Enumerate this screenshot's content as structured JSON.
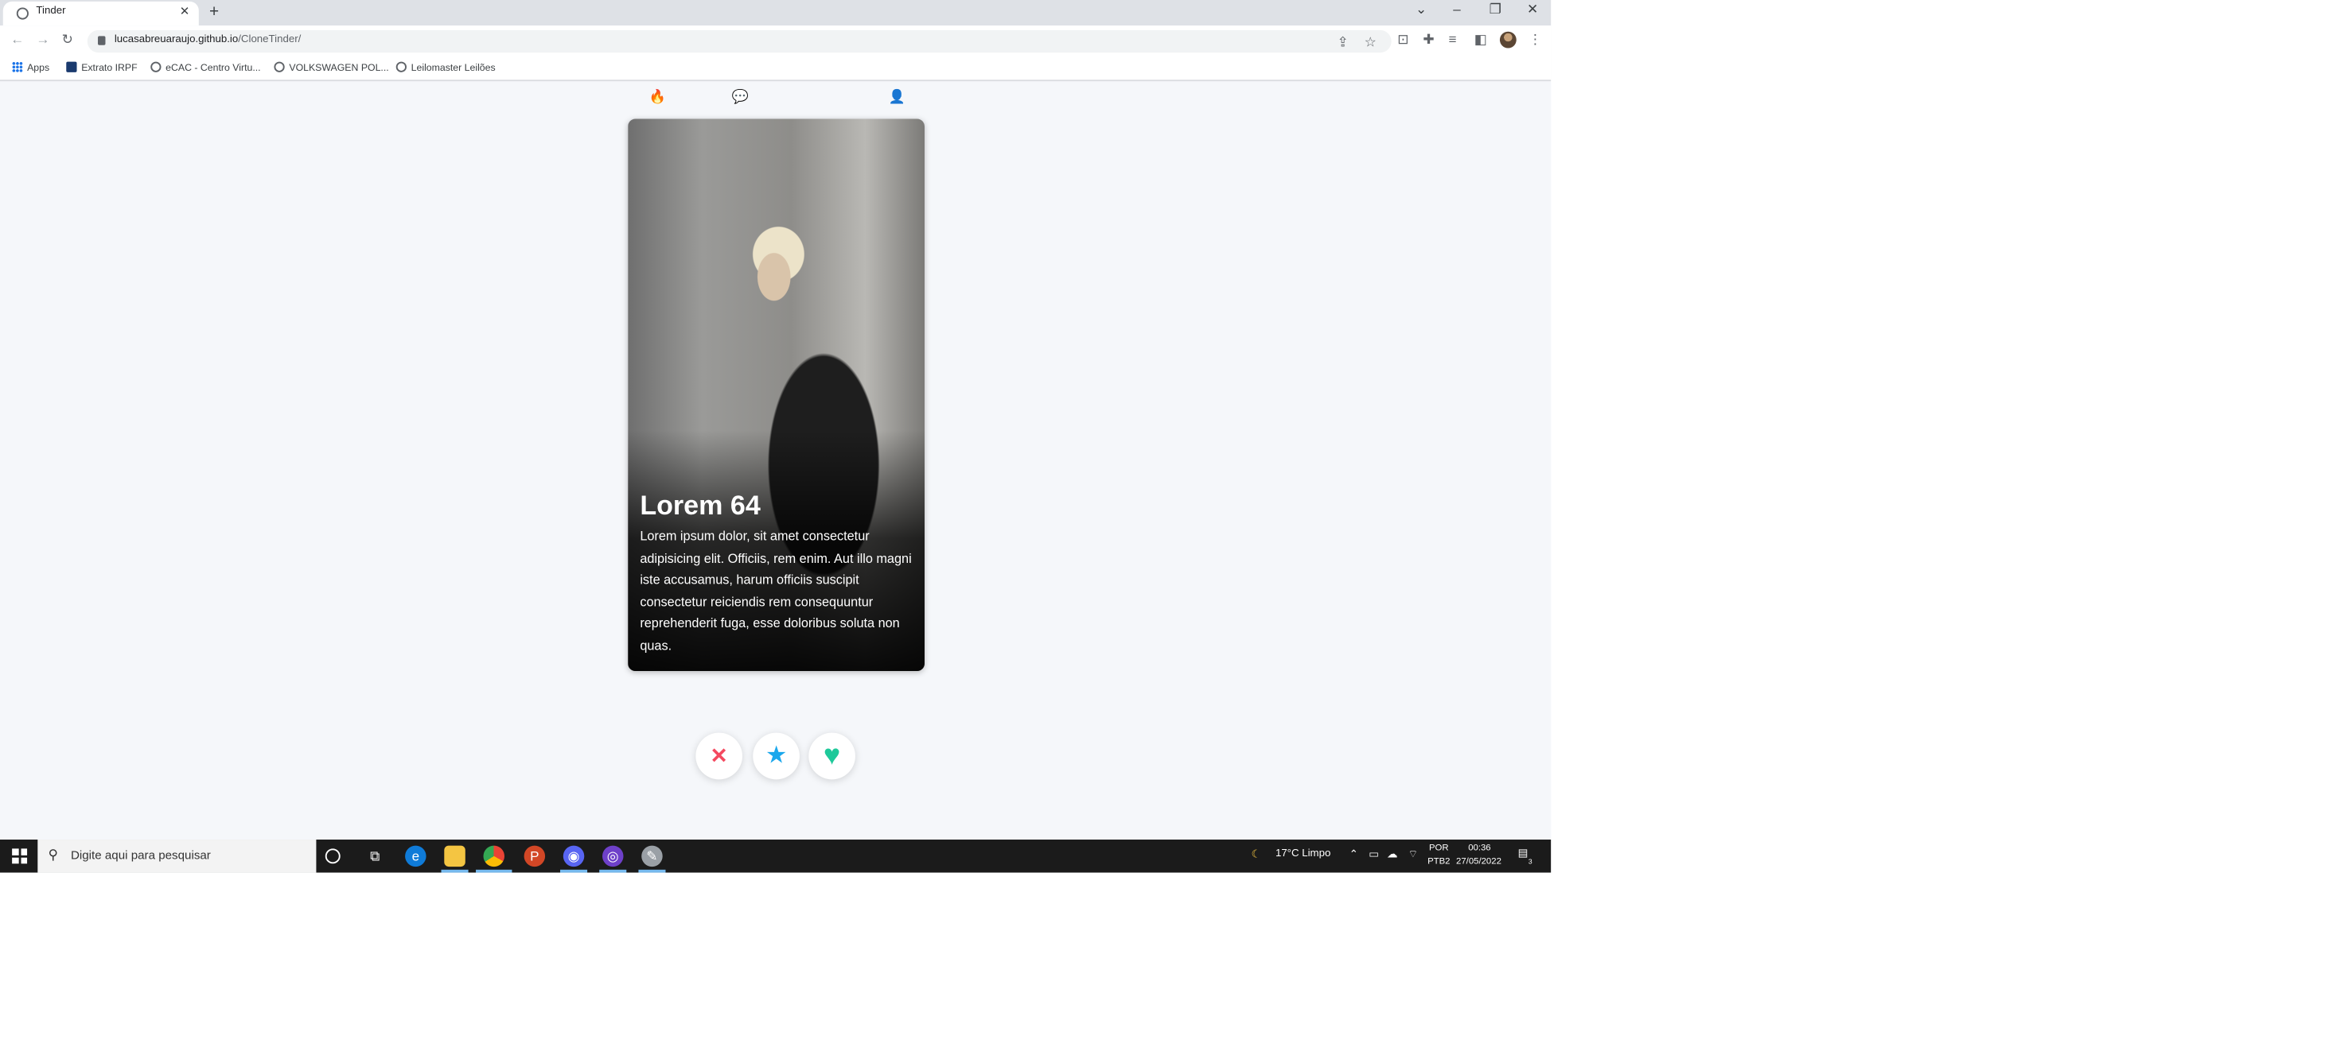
{
  "browser": {
    "tab_title": "Tinder",
    "new_tab_symbol": "+",
    "url_domain": "lucasabreuaraujo.github.io",
    "url_path": "/CloneTinder/",
    "window_controls": {
      "dropdown": "⌄",
      "minimize": "–",
      "restore": "❐",
      "close": "✕"
    }
  },
  "bookmarks": [
    {
      "label": "Apps",
      "icon": "apps-grid-icon"
    },
    {
      "label": "Extrato IRPF",
      "icon": "extrato-icon"
    },
    {
      "label": "eCAC - Centro Virtu...",
      "icon": "globe-icon"
    },
    {
      "label": "VOLKSWAGEN POL...",
      "icon": "globe-icon"
    },
    {
      "label": "Leilomaster Leilões",
      "icon": "globe-icon"
    }
  ],
  "app_nav": {
    "icons": [
      "flame-icon",
      "chat-icon",
      "user-icon"
    ],
    "active_color": "#fd5068",
    "inactive_color": "#c9ccd1"
  },
  "profile_card": {
    "name_age": "Lorem 64",
    "bio": "Lorem ipsum dolor, sit amet consectetur adipisicing elit. Officiis, rem enim. Aut illo magni iste accusamus, harum officiis suscipit consectetur reiciendis rem consequuntur reprehenderit fuga, esse doloribus soluta non quas."
  },
  "actions": {
    "dislike": {
      "icon": "close-icon",
      "symbol": "✕",
      "color": "#f4495f"
    },
    "superlike": {
      "icon": "star-icon",
      "symbol": "★",
      "color": "#1aa7ec"
    },
    "like": {
      "icon": "heart-icon",
      "symbol": "♥",
      "color": "#1ec99a"
    }
  },
  "taskbar": {
    "search_placeholder": "Digite aqui para pesquisar",
    "weather": "17°C  Limpo",
    "language_line1": "POR",
    "language_line2": "PTB2",
    "time": "00:36",
    "date": "27/05/2022",
    "notification_count": "3"
  }
}
